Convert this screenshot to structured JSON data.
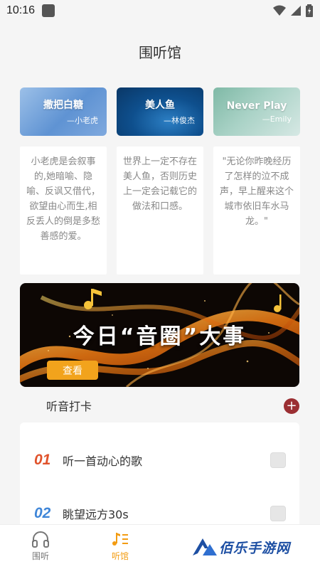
{
  "status_bar": {
    "time": "10:16"
  },
  "page": {
    "title": "围听馆"
  },
  "cards": [
    {
      "title": "撒把白糖",
      "author": "—小老虎"
    },
    {
      "title": "美人鱼",
      "author": "—林俊杰"
    },
    {
      "title": "Never Play",
      "author": "—Emily"
    }
  ],
  "quotes": [
    "小老虎是会叙事的,她暗喻、隐喻、反讽又借代，欲望由心而生,相反丢人的倒是多愁善感的爱。",
    "世界上一定不存在美人鱼，否则历史上一定会记载它的做法和口感。",
    "\"无论你昨晚经历了怎样的泣不成声，早上醒来这个城市依旧车水马龙。\""
  ],
  "banner": {
    "title": "今日“音圈”大事",
    "button_label": "查看"
  },
  "checkin": {
    "title": "听音打卡",
    "add_label": "+",
    "tasks": [
      {
        "num": "01",
        "label": "听一首动心的歌",
        "color": "#e0522b"
      },
      {
        "num": "02",
        "label": "眺望远方30s",
        "color": "#3f86d8"
      }
    ]
  },
  "tabs": [
    {
      "label": "围听",
      "icon": "headphones-icon"
    },
    {
      "label": "听馆",
      "icon": "music-list-icon"
    }
  ],
  "watermark": {
    "text": "佰乐手游网"
  },
  "colors": {
    "accent": "#f39c12",
    "add_button": "#9b2f33",
    "banner_button": "#f2a31c"
  }
}
